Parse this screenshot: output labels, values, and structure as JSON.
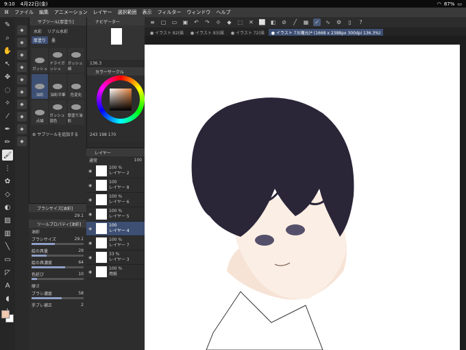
{
  "status": {
    "time": "9:10",
    "date": "4月22日(金)",
    "wifi": "wifi-icon",
    "battery": "87%"
  },
  "menu": [
    "ファイル",
    "編集",
    "アニメーション",
    "レイヤー",
    "選択範囲",
    "表示",
    "フィルター",
    "ウィンドウ",
    "ヘルプ"
  ],
  "tabs": [
    "● イラスト 82(描",
    "● イラスト 83(描",
    "● イラスト 72(描",
    "● イラスト 73(複元)* (1668 x 2388px 300dpi 136.3%)"
  ],
  "subtool": {
    "title": "サブツール[厚塗り]",
    "tabs": [
      "水彩",
      "リアル水彩",
      "厚塗り",
      "墨"
    ],
    "brushes": [
      "ガッシュ",
      "ドライガッシュ",
      "ガッシュ細",
      "油彩",
      "油彩平筆",
      "色変化",
      "点描",
      "ガッシュ混色",
      "厚塗り油彩"
    ],
    "add": "サブツールを追加する"
  },
  "brush_size_title": "ブラシサイズ[油彩]",
  "brush_size_value": "29.1",
  "props": {
    "title": "ツールプロパティ[油彩]",
    "tool": "油彩",
    "rows": [
      {
        "label": "ブラシサイズ",
        "value": "29.1"
      },
      {
        "label": "絵の具量",
        "value": "29"
      },
      {
        "label": "絵の具濃度",
        "value": "64"
      },
      {
        "label": "色延び",
        "value": "10"
      },
      {
        "label": "硬さ",
        "value": ""
      },
      {
        "label": "ブラシ濃度",
        "value": "58"
      },
      {
        "label": "手ブレ補正",
        "value": "2"
      }
    ]
  },
  "navigator": {
    "title": "ナビゲーター",
    "zoom": "136.3"
  },
  "color": {
    "title": "カラーサークル",
    "r": "243",
    "g": "198",
    "b": "170"
  },
  "layers": {
    "title": "レイヤー",
    "mode": "通常",
    "opacity": "100",
    "items": [
      {
        "pct": "100 %",
        "name": "レイヤー 2"
      },
      {
        "pct": "100",
        "name": "レイヤー 8"
      },
      {
        "pct": "100 %",
        "name": "レイヤー 6"
      },
      {
        "pct": "100 %",
        "name": "レイヤー 5"
      },
      {
        "pct": "100",
        "name": "レイヤー 4"
      },
      {
        "pct": "100 %",
        "name": "レイヤー 7"
      },
      {
        "pct": "33 %",
        "name": "レイヤー 3"
      },
      {
        "pct": "100 %",
        "name": "用紙"
      }
    ]
  }
}
